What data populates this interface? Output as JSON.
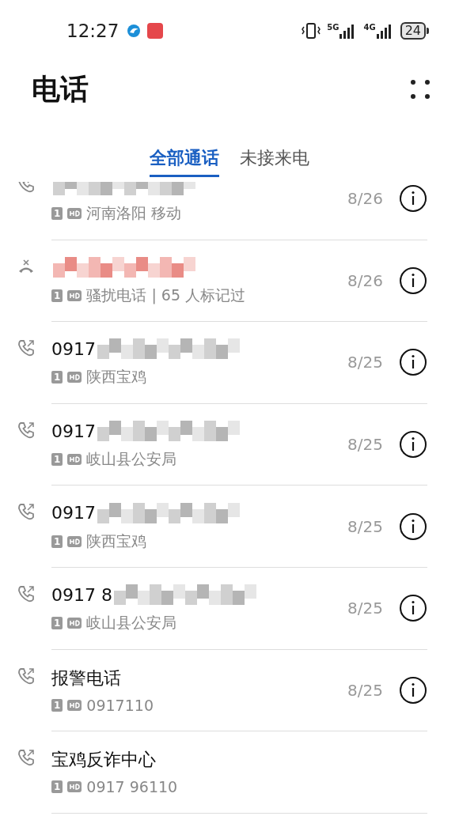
{
  "status_bar": {
    "time": "12:27",
    "network_1": "5G",
    "network_2": "4G",
    "battery": "24"
  },
  "header": {
    "title": "电话"
  },
  "tabs": [
    {
      "label": "全部通话",
      "selected": true
    },
    {
      "label": "未接来电",
      "selected": false
    }
  ],
  "calls": [
    {
      "kind": "outgoing",
      "redacted": true,
      "missed": false,
      "sim": "1",
      "detail": "河南洛阳 移动",
      "date": "8/26"
    },
    {
      "kind": "rejected",
      "redacted": true,
      "missed": true,
      "sim": "1",
      "detail": "骚扰电话 | 65 人标记过",
      "date": "8/26"
    },
    {
      "kind": "outgoing",
      "name": "0917",
      "redacted": true,
      "missed": false,
      "sim": "1",
      "detail": "陕西宝鸡",
      "date": "8/25"
    },
    {
      "kind": "outgoing",
      "name": "0917",
      "redacted": true,
      "missed": false,
      "sim": "1",
      "detail": "岐山县公安局",
      "date": "8/25"
    },
    {
      "kind": "outgoing",
      "name": "0917",
      "redacted": true,
      "missed": false,
      "sim": "1",
      "detail": "陕西宝鸡",
      "date": "8/25"
    },
    {
      "kind": "outgoing",
      "name": "0917 8",
      "redacted": true,
      "missed": false,
      "sim": "1",
      "detail": "岐山县公安局",
      "date": "8/25"
    },
    {
      "kind": "outgoing",
      "name": "报警电话",
      "redacted": false,
      "missed": false,
      "sim": "1",
      "detail": "0917110",
      "date": "8/25"
    },
    {
      "kind": "outgoing",
      "name": "宝鸡反诈中心",
      "redacted": false,
      "missed": false,
      "sim": "1",
      "detail": "0917 96110"
    }
  ]
}
